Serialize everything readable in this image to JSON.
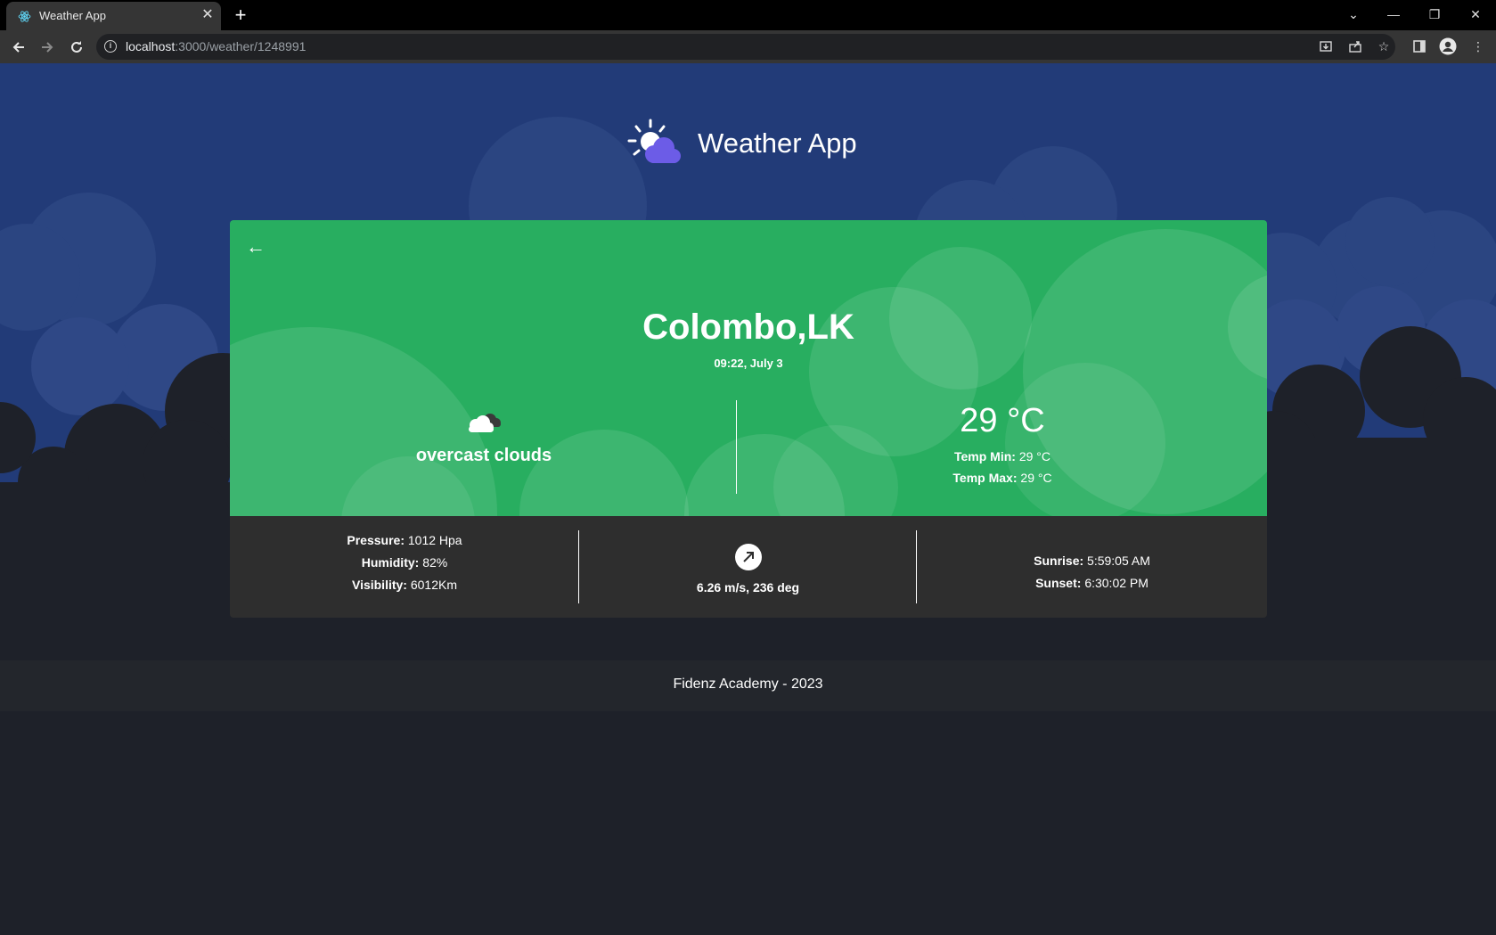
{
  "browser": {
    "tab_title": "Weather App",
    "tab_close": "✕",
    "new_tab": "+",
    "url_host": "localhost",
    "url_path": ":3000/weather/1248991",
    "icons": [
      "back-arrow",
      "forward-arrow",
      "reload",
      "info",
      "install",
      "share",
      "star",
      "sidebar",
      "profile",
      "menu"
    ]
  },
  "header": {
    "app_title": "Weather App"
  },
  "weather": {
    "back_symbol": "←",
    "city": "Colombo,LK",
    "datetime": "09:22, July 3",
    "description": "overcast clouds",
    "temperature": "29 °C",
    "temp_min_label": "Temp Min:",
    "temp_min_value": "29 °C",
    "temp_max_label": "Temp Max:",
    "temp_max_value": "29 °C"
  },
  "details": {
    "pressure_label": "Pressure:",
    "pressure_value": "1012 Hpa",
    "humidity_label": "Humidity:",
    "humidity_value": "82%",
    "visibility_label": "Visibility:",
    "visibility_value": "6012Km",
    "wind_text": "6.26 m/s, 236 deg",
    "sunrise_label": "Sunrise:",
    "sunrise_value": "5:59:05 AM",
    "sunset_label": "Sunset:",
    "sunset_value": "6:30:02 PM"
  },
  "footer": {
    "text": "Fidenz Academy - 2023"
  },
  "colors": {
    "sky": "#223b78",
    "card_green": "#28ae60",
    "card_dark": "#2e2e2e",
    "page_bg": "#1e2129",
    "brand_cloud": "#6c5ce7"
  }
}
